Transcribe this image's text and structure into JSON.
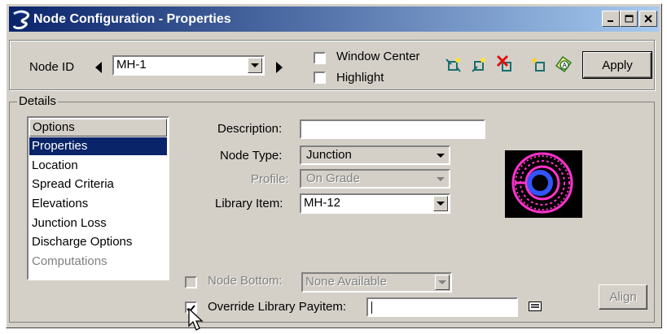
{
  "window": {
    "title": "Node Configuration - Properties",
    "controls": [
      "_",
      "□",
      "X"
    ]
  },
  "toolbar": {
    "node_id_label": "Node ID",
    "node_id_value": "MH-1",
    "window_center_label": "Window Center",
    "highlight_label": "Highlight",
    "apply_label": "Apply",
    "icons": [
      "node-pick-icon",
      "node-add-icon",
      "node-delete-icon",
      "node-new-icon",
      "node-annotate-icon"
    ]
  },
  "details": {
    "label": "Details",
    "options_header": "Options",
    "options": [
      {
        "label": "Properties",
        "selected": true,
        "enabled": true
      },
      {
        "label": "Location",
        "selected": false,
        "enabled": true
      },
      {
        "label": "Spread Criteria",
        "selected": false,
        "enabled": true
      },
      {
        "label": "Elevations",
        "selected": false,
        "enabled": true
      },
      {
        "label": "Junction Loss",
        "selected": false,
        "enabled": true
      },
      {
        "label": "Discharge Options",
        "selected": false,
        "enabled": true
      },
      {
        "label": "Computations",
        "selected": false,
        "enabled": false
      }
    ],
    "description_label": "Description:",
    "description_value": "",
    "node_type_label": "Node Type:",
    "node_type_value": "Junction",
    "profile_label": "Profile:",
    "profile_value": "On Grade",
    "library_item_label": "Library Item:",
    "library_item_value": "MH-12",
    "node_bottom_label": "Node Bottom:",
    "node_bottom_value": "None Available",
    "override_label": "Override Library Payitem:",
    "override_value": "",
    "align_label": "Align"
  },
  "colors": {
    "titlebar": "#0a246a",
    "selection": "#0a246a",
    "preview_ring": "#ff33cc",
    "preview_center": "#3355ff"
  }
}
